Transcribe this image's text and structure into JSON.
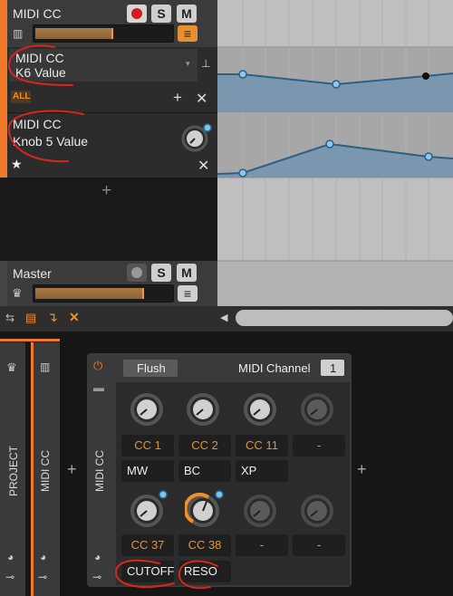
{
  "tracks": [
    {
      "name": "MIDI CC",
      "solo": "S",
      "mute": "M"
    },
    {
      "name": "Master",
      "solo": "S",
      "mute": "M"
    }
  ],
  "automation_lanes": [
    {
      "line1": "MIDI CC",
      "line2": "K6 Value",
      "filter": "ALL"
    },
    {
      "line1": "MIDI CC",
      "line2": "Knob 5 Value"
    }
  ],
  "device": {
    "flush_label": "Flush",
    "channel_label": "MIDI Channel",
    "channel_value": "1",
    "name": "MIDI CC",
    "row1_cc": [
      "CC 1",
      "CC 2",
      "CC 11",
      "-"
    ],
    "row1_names": [
      "MW",
      "BC",
      "XP"
    ],
    "row2_cc": [
      "CC 37",
      "CC 38",
      "-",
      "-"
    ],
    "row2_names": [
      "CUTOFF",
      "RESO"
    ]
  },
  "bottom_tracks": [
    {
      "label": "PROJECT"
    },
    {
      "label": "MIDI CC"
    }
  ],
  "colors": {
    "accent": "#f07a2a",
    "automation": "#2f5f86"
  }
}
